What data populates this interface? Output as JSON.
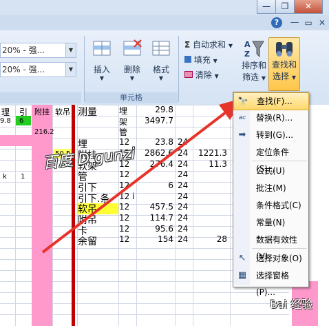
{
  "title_bar": {
    "minimize": "—",
    "restore": "❐",
    "close": "✕"
  },
  "ribbon_right": {
    "help": "?",
    "restore": "▭",
    "close": "✕"
  },
  "styles": {
    "box1": "20% - 强...",
    "box2": "20% - 强..."
  },
  "cells_group": {
    "label": "单元格",
    "insert": "插入",
    "delete": "删除",
    "format": "格式"
  },
  "editing_group": {
    "autosum": "自动求和",
    "fill": "填充",
    "clear": "清除",
    "sort_filter_line1": "排序和",
    "sort_filter_line2": "筛选",
    "find_select_line1": "查找和",
    "find_select_line2": "选择"
  },
  "sheet_left": {
    "header_cells": [
      "理",
      "引",
      "附挂",
      "软吊"
    ],
    "row1": [
      "9.8",
      "6"
    ],
    "row2": "216.2",
    "row3": "50.5",
    "row4": [
      "k",
      "1"
    ]
  },
  "sheet_rows": [
    {
      "name": "测量",
      "type": "埋",
      "v1": "29.8",
      "v2": "",
      "v3": "",
      "v4": ""
    },
    {
      "name": "",
      "type": "架",
      "v1": "3497.7",
      "v2": "",
      "v3": "",
      "v4": ""
    },
    {
      "name": "",
      "type": "管",
      "v1": "",
      "v2": "",
      "v3": "",
      "v4": ""
    },
    {
      "name": "埋",
      "type": "12",
      "v1": "23.8",
      "v2": "24",
      "v3": "",
      "v4": ""
    },
    {
      "name": "附挂",
      "type": "12",
      "v1": "2862.6",
      "v2": "24",
      "v3": "1221.3",
      "v4": ""
    },
    {
      "name": "软架",
      "type": "12",
      "v1": "276.4",
      "v2": "24",
      "v3": "11.3",
      "v4": ""
    },
    {
      "name": "管",
      "type": "12",
      "v1": "",
      "v2": "24",
      "v3": "",
      "v4": ""
    },
    {
      "name": "引下",
      "type": "12",
      "v1": "6",
      "v2": "24",
      "v3": "",
      "v4": ""
    },
    {
      "name": "引下.条",
      "type": "12 i",
      "v1": "",
      "v2": "24",
      "v3": "",
      "v4": ""
    },
    {
      "name": "软吊",
      "type": "12",
      "v1": "457.5",
      "v2": "24",
      "v3": "",
      "v4": ""
    },
    {
      "name": "附吊",
      "type": "12",
      "v1": "114.7",
      "v2": "24",
      "v3": "",
      "v4": ""
    },
    {
      "name": "卡",
      "type": "12",
      "v1": "95.6",
      "v2": "24",
      "v3": "",
      "v4": ""
    },
    {
      "name": "余留",
      "type": "12",
      "v1": "154",
      "v2": "24",
      "v3": "28",
      "v4": ""
    }
  ],
  "watermark": "百度 D gunzi",
  "watermark_bottom": "Bai 经验",
  "menu": {
    "items": [
      {
        "label": "查找(F)...",
        "icon": "binoculars-icon"
      },
      {
        "label": "替换(R)...",
        "icon": "replace-icon"
      },
      {
        "label": "转到(G)...",
        "icon": "arrow-right-icon"
      },
      {
        "label": "定位条件(S)...",
        "icon": ""
      },
      {
        "label": "公式(U)",
        "icon": ""
      },
      {
        "label": "批注(M)",
        "icon": ""
      },
      {
        "label": "条件格式(C)",
        "icon": ""
      },
      {
        "label": "常量(N)",
        "icon": ""
      },
      {
        "label": "数据有效性(V)",
        "icon": ""
      },
      {
        "label": "选择对象(O)",
        "icon": "cursor-icon"
      },
      {
        "label": "选择窗格(P)...",
        "icon": "selection-pane-icon"
      }
    ]
  },
  "colors": {
    "accent_arrow": "#e8332a",
    "pink_column": "#ff99cc",
    "highlight": "#ffd86c"
  }
}
